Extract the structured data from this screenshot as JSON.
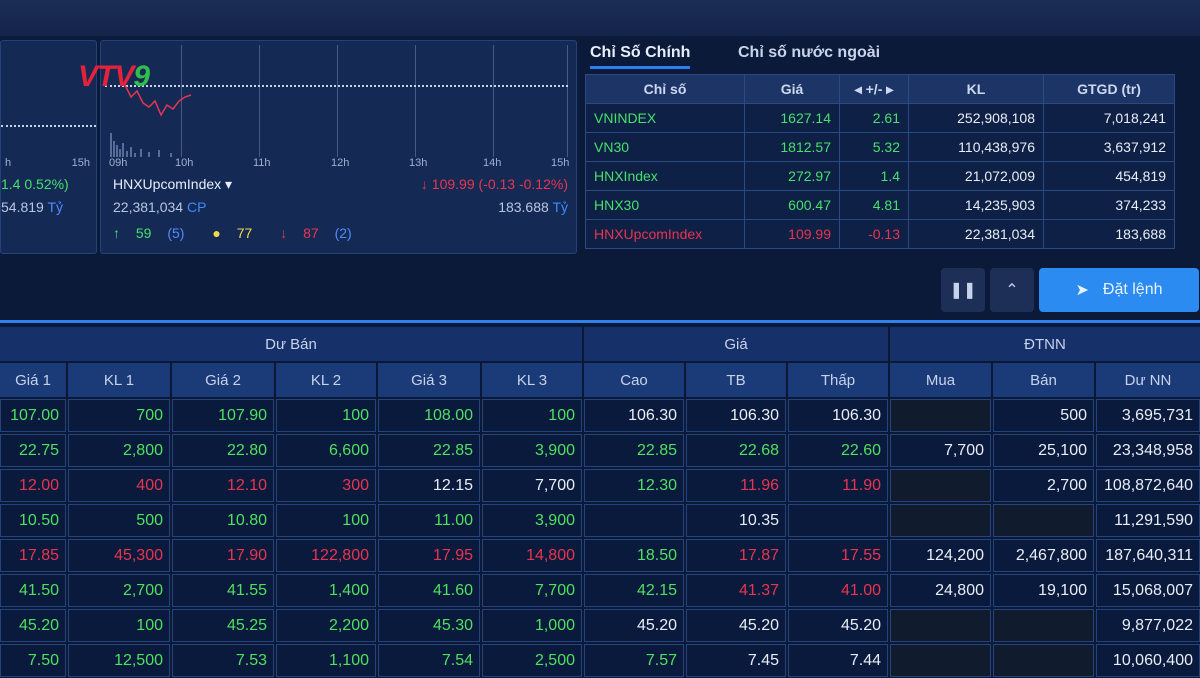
{
  "logo": {
    "text_a": "VTV",
    "text_b": "9"
  },
  "left_mini": {
    "change": "1.4 0.52%)",
    "value": "54.819",
    "unit": "Tỷ",
    "tick": "15h",
    "tick2": "h"
  },
  "mid_mini": {
    "ticks": [
      "09h",
      "10h",
      "11h",
      "12h",
      "13h",
      "14h",
      "15h"
    ],
    "name": "HNXUpcomIndex",
    "change": "109.99 (-0.13 -0.12%)",
    "volume": "22,381,034",
    "volume_unit": "CP",
    "value": "183.688",
    "value_unit": "Tỷ",
    "adv": "59",
    "adv_ceil": "(5)",
    "unch": "77",
    "dec": "87",
    "dec_floor": "(2)"
  },
  "summary": {
    "tabs": [
      "Chỉ Số Chính",
      "Chỉ số nước ngoài"
    ],
    "headers": [
      "Chỉ số",
      "Giá",
      "+/-",
      "KL",
      "GTGD (tr)"
    ],
    "rows": [
      {
        "name": "VNINDEX",
        "price": "1627.14",
        "chg": "2.61",
        "vol": "252,908,108",
        "val": "7,018,241",
        "color": "g"
      },
      {
        "name": "VN30",
        "price": "1812.57",
        "chg": "5.32",
        "vol": "110,438,976",
        "val": "3,637,912",
        "color": "g"
      },
      {
        "name": "HNXIndex",
        "price": "272.97",
        "chg": "1.4",
        "vol": "21,072,009",
        "val": "454,819",
        "color": "g"
      },
      {
        "name": "HNX30",
        "price": "600.47",
        "chg": "4.81",
        "vol": "14,235,903",
        "val": "374,233",
        "color": "g"
      },
      {
        "name": "HNXUpcomIndex",
        "price": "109.99",
        "chg": "-0.13",
        "vol": "22,381,034",
        "val": "183,688",
        "color": "r"
      }
    ]
  },
  "buttons": {
    "order": "Đặt lệnh"
  },
  "board": {
    "groups": [
      "Dư Bán",
      "Giá",
      "ĐTNN"
    ],
    "columns": [
      "Giá 1",
      "KL 1",
      "Giá 2",
      "KL 2",
      "Giá 3",
      "KL 3",
      "Cao",
      "TB",
      "Thấp",
      "Mua",
      "Bán",
      "Dư NN"
    ],
    "rows": [
      {
        "c": [
          "107.00",
          "700",
          "107.90",
          "100",
          "108.00",
          "100",
          "106.30",
          "106.30",
          "106.30",
          "",
          "500",
          "3,695,731"
        ],
        "k": [
          "g",
          "g",
          "g",
          "g",
          "g",
          "g",
          "w",
          "w",
          "w",
          "w",
          "w",
          "w"
        ]
      },
      {
        "c": [
          "22.75",
          "2,800",
          "22.80",
          "6,600",
          "22.85",
          "3,900",
          "22.85",
          "22.68",
          "22.60",
          "7,700",
          "25,100",
          "23,348,958"
        ],
        "k": [
          "g",
          "g",
          "g",
          "g",
          "g",
          "g",
          "g",
          "g",
          "g",
          "w",
          "w",
          "w"
        ]
      },
      {
        "c": [
          "12.00",
          "400",
          "12.10",
          "300",
          "12.15",
          "7,700",
          "12.30",
          "11.96",
          "11.90",
          "",
          "2,700",
          "108,872,640"
        ],
        "k": [
          "r",
          "r",
          "r",
          "r",
          "w",
          "w",
          "g",
          "r",
          "r",
          "w",
          "w",
          "w"
        ]
      },
      {
        "c": [
          "10.50",
          "500",
          "10.80",
          "100",
          "11.00",
          "3,900",
          "",
          "10.35",
          "",
          "",
          "",
          "11,291,590"
        ],
        "k": [
          "g",
          "g",
          "g",
          "g",
          "g",
          "g",
          "w",
          "w",
          "w",
          "w",
          "w",
          "w"
        ]
      },
      {
        "c": [
          "17.85",
          "45,300",
          "17.90",
          "122,800",
          "17.95",
          "14,800",
          "18.50",
          "17.87",
          "17.55",
          "124,200",
          "2,467,800",
          "187,640,311"
        ],
        "k": [
          "r",
          "r",
          "r",
          "r",
          "r",
          "r",
          "g",
          "r",
          "r",
          "w",
          "w",
          "w"
        ]
      },
      {
        "c": [
          "41.50",
          "2,700",
          "41.55",
          "1,400",
          "41.60",
          "7,700",
          "42.15",
          "41.37",
          "41.00",
          "24,800",
          "19,100",
          "15,068,007"
        ],
        "k": [
          "g",
          "g",
          "g",
          "g",
          "g",
          "g",
          "g",
          "r",
          "r",
          "w",
          "w",
          "w"
        ]
      },
      {
        "c": [
          "45.20",
          "100",
          "45.25",
          "2,200",
          "45.30",
          "1,000",
          "45.20",
          "45.20",
          "45.20",
          "",
          "",
          "9,877,022"
        ],
        "k": [
          "g",
          "g",
          "g",
          "g",
          "g",
          "g",
          "w",
          "w",
          "w",
          "w",
          "w",
          "w"
        ]
      },
      {
        "c": [
          "7.50",
          "12,500",
          "7.53",
          "1,100",
          "7.54",
          "2,500",
          "7.57",
          "7.45",
          "7.44",
          "",
          "",
          "10,060,400"
        ],
        "k": [
          "g",
          "g",
          "g",
          "g",
          "g",
          "g",
          "g",
          "w",
          "w",
          "w",
          "w",
          "w"
        ]
      }
    ]
  },
  "colors": {
    "up": "#46e06a",
    "down": "#e8354f",
    "ref": "#f2d94a",
    "accent": "#2b8bf0"
  }
}
